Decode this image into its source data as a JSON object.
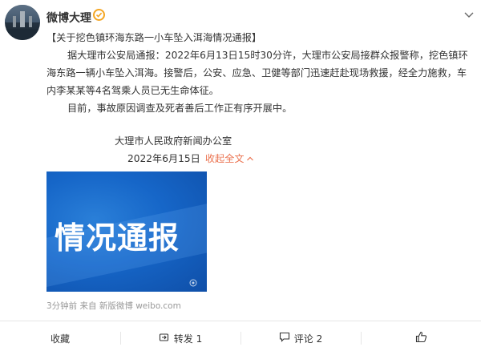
{
  "post": {
    "author": "微博大理",
    "title": "【关于挖色镇环海东路一小车坠入洱海情况通报】",
    "paragraph1": "据大理市公安局通报：2022年6月13日15时30分许，大理市公安局接群众报警称，挖色镇环海东路一辆小车坠入洱海。接警后，公安、应急、卫健等部门迅速赶赴现场救援，经全力施救，车内李某某等4名驾乘人员已无生命体征。",
    "paragraph2": "目前，事故原因调查及死者善后工作正有序开展中。",
    "signature": "大理市人民政府新闻办公室",
    "date": "2022年6月15日",
    "expand_label": "收起全文",
    "image_text": "情况通报",
    "meta": "3分钟前  来自 新版微博 weibo.com"
  },
  "actions": {
    "favorite": "收藏",
    "repost": "转发 1",
    "comment": "评论 2",
    "like": ""
  },
  "colors": {
    "accent": "#eb7350",
    "verified": "#f4a623",
    "image_blue": "#1666c8"
  },
  "icons": [
    "verified-icon",
    "chevron-down-icon",
    "repost-icon",
    "comment-icon",
    "like-icon",
    "chevron-up-icon"
  ]
}
